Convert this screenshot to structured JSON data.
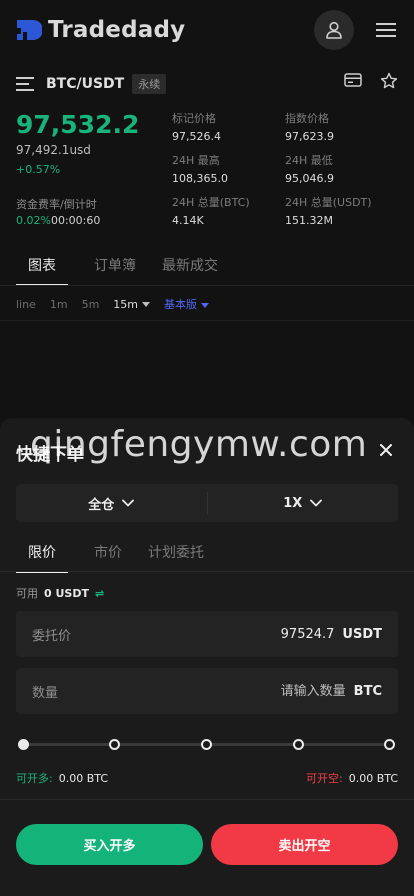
{
  "header": {
    "app_name": "Tradedady",
    "icons": [
      "logo-icon",
      "user-icon",
      "hamburger-menu-icon"
    ]
  },
  "pair": {
    "symbol": "BTC/USDT",
    "tag": "永续",
    "icons": [
      "list-icon",
      "card-icon",
      "star-icon"
    ]
  },
  "price": {
    "last": "97,532.2",
    "usd": "97,492.1usd",
    "change": "+0.57%",
    "funding_label": "资金费率/倒计时",
    "funding_rate": "0.02%",
    "countdown": "00:00:60"
  },
  "stats": [
    {
      "label": "标记价格",
      "value": "97,526.4"
    },
    {
      "label": "指数价格",
      "value": "97,623.9"
    },
    {
      "label": "24H 最高",
      "value": "108,365.0"
    },
    {
      "label": "24H 最低",
      "value": "95,046.9"
    },
    {
      "label": "24H 总量(BTC)",
      "value": "4.14K"
    },
    {
      "label": "24H 总量(USDT)",
      "value": "151.32M"
    }
  ],
  "tabs": [
    "图表",
    "订单簿",
    "最新成交"
  ],
  "intervals": {
    "items": [
      "line",
      "1m",
      "5m"
    ],
    "selected": "15m",
    "version": "基本版"
  },
  "sheet": {
    "title": "快捷下单",
    "margin_mode": "全仓",
    "leverage": "1X",
    "order_tabs": [
      "限价",
      "市价",
      "计划委托"
    ],
    "available_label": "可用",
    "available_amount": "0 USDT",
    "swap_symbol": "⇌",
    "price_field": {
      "label": "委托价",
      "value": "97524.7",
      "unit": "USDT"
    },
    "qty_field": {
      "label": "数量",
      "placeholder": "请输入数量",
      "unit": "BTC"
    },
    "slider_percent": 0,
    "open_long_label": "可开多:",
    "open_long_value": "0.00 BTC",
    "open_short_label": "可开空:",
    "open_short_value": "0.00 BTC",
    "buy_label": "买入开多",
    "sell_label": "卖出开空"
  },
  "watermark": "qingfengymw.com",
  "colors": {
    "up": "#18b47b",
    "down": "#f13a45",
    "accent": "#4f67f2",
    "logo": "#2c58d6"
  }
}
